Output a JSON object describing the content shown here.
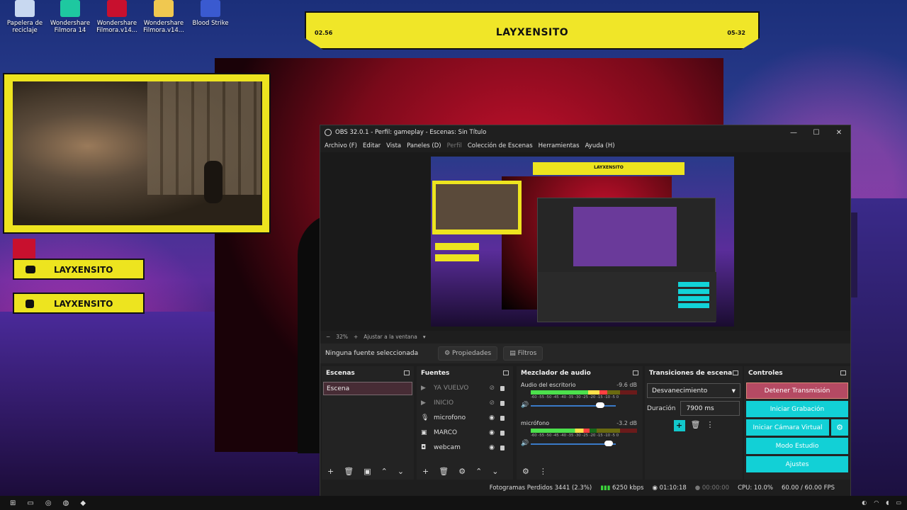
{
  "desktop": {
    "icons": [
      {
        "label": "Papelera de reciclaje",
        "color": "#c8d8f0"
      },
      {
        "label": "Wondershare Filmora 14",
        "color": "#1ec8a0"
      },
      {
        "label": "Wondershare Filmora.v14...",
        "color": "#c8102e"
      },
      {
        "label": "Wondershare Filmora.v14...",
        "color": "#f0c850"
      },
      {
        "label": "Blood Strike",
        "color": "#3a5ad0"
      }
    ]
  },
  "overlay": {
    "banner_title": "LAYXENSITO",
    "banner_left": "02.56",
    "banner_right": "05-32",
    "youtube_label": "LAYXENSITO",
    "instagram_label": "LAYXENSITO"
  },
  "obs": {
    "title": "OBS 32.0.1 - Perfil: gameplay - Escenas: Sin Título",
    "menu": [
      "Archivo (F)",
      "Editar",
      "Vista",
      "Paneles (D)",
      "Perfil",
      "Colección de Escenas",
      "Herramientas",
      "Ayuda (H)"
    ],
    "zoom": {
      "minus": "−",
      "value": "32%",
      "plus": "+",
      "fit": "Ajustar a la ventana"
    },
    "preview_banner": "LAYXENSITO",
    "source_bar": {
      "none_selected": "Ninguna fuente seleccionada",
      "properties": "Propiedades",
      "filters": "Filtros"
    },
    "scenes": {
      "title": "Escenas",
      "items": [
        "Escena"
      ]
    },
    "sources": {
      "title": "Fuentes",
      "items": [
        {
          "name": "YA VUELVO",
          "icon": "play-icon",
          "visible": false
        },
        {
          "name": "INICIO",
          "icon": "play-icon",
          "visible": false
        },
        {
          "name": "microfono",
          "icon": "microphone-icon",
          "visible": true
        },
        {
          "name": "MARCO",
          "icon": "image-icon",
          "visible": true
        },
        {
          "name": "webcam",
          "icon": "camera-icon",
          "visible": true
        }
      ]
    },
    "mixer": {
      "title": "Mezclador de audio",
      "scale": "-60 -55 -50 -45 -40 -35 -30 -25 -20 -15 -10 -5 0",
      "channels": [
        {
          "name": "Audio del escritorio",
          "db": "-9.6 dB",
          "level": 0.72,
          "volume": 0.82
        },
        {
          "name": "micrófono",
          "db": "-3.2 dB",
          "level": 0.55,
          "volume": 0.92
        }
      ]
    },
    "transitions": {
      "title": "Transiciones de escena",
      "type": "Desvanecimiento",
      "duration_label": "Duración",
      "duration": "7900 ms"
    },
    "controls": {
      "title": "Controles",
      "stop_stream": "Detener Transmisión",
      "start_recording": "Iniciar Grabación",
      "start_virtual_cam": "Iniciar Cámara Virtual",
      "studio_mode": "Modo Estudio",
      "settings": "Ajustes"
    },
    "status": {
      "dropped": "Fotogramas Perdidos 3441 (2.3%)",
      "bitrate": "6250 kbps",
      "stream_time": "01:10:18",
      "rec_time": "00:00:00",
      "cpu": "CPU: 10.0%",
      "fps": "60.00 / 60.00 FPS"
    }
  },
  "colors": {
    "accent": "#12d0d6",
    "overlay_yellow": "#ede41f",
    "stop_button": "#b54a63"
  }
}
